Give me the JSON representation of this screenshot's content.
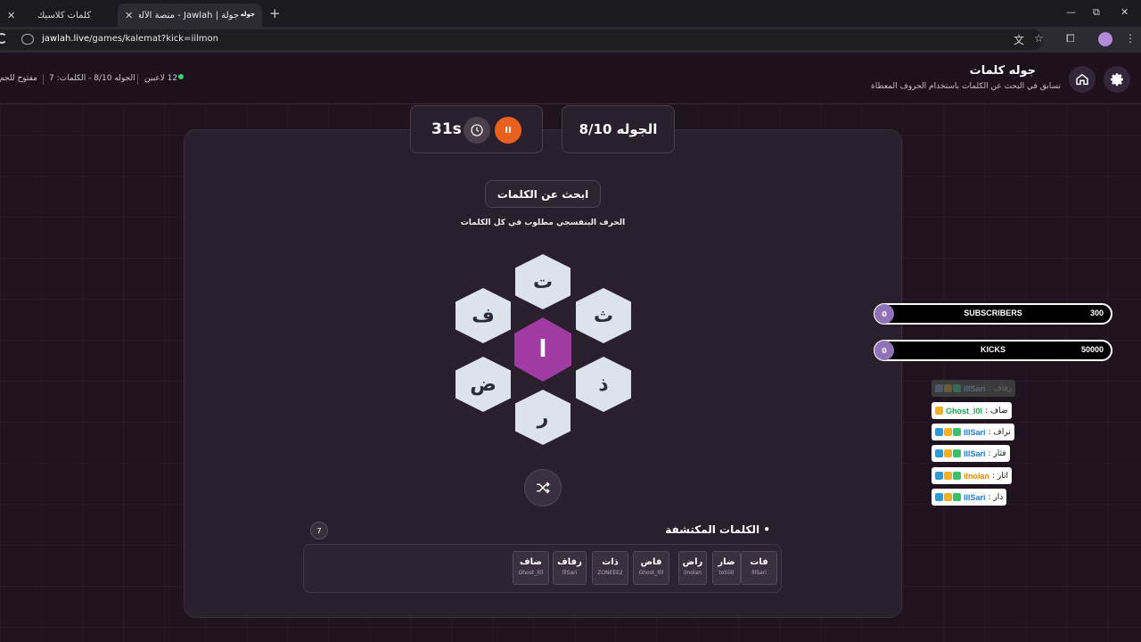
{
  "browser": {
    "tabs": [
      {
        "title": "كلمات كلاسيك"
      },
      {
        "title": "جولة | Jawlah - منصة الألعاب التـ"
      }
    ],
    "favicon_text": "جوله",
    "url_host": "jawlah.live",
    "url_path": "/games/kalemat?kick=iilmon",
    "new_tab": "+",
    "close": "✕",
    "min": "—",
    "restore": "⧉",
    "closewin": "✕"
  },
  "header": {
    "title": "جوله كلمات",
    "subtitle": "تسابق في البحث عن الكلمات باستخدام الحروف المعطاة",
    "players": "12 لاعبين",
    "round_words": "الجوله 8/10 - الكلمات: 7",
    "open": "مفتوح للجم"
  },
  "round": {
    "label": "الجوله 8/10"
  },
  "timer": {
    "value": "31s",
    "pause": "II"
  },
  "game": {
    "search_title": "ابحث عن الكلمات",
    "hint": "الحرف البنفسجي مطلوب في كل الكلمات",
    "center_letter": "ا",
    "letters": {
      "top": "ت",
      "top_right": "ث",
      "bottom_right": "ذ",
      "bottom": "ر",
      "bottom_left": "ض",
      "top_left": "ف"
    }
  },
  "found": {
    "title": "الكلمات المكتشفة",
    "bullet": "•",
    "count": "7",
    "words": [
      {
        "word": "فات",
        "player": "lllSari"
      },
      {
        "word": "ضار",
        "player": "totiii0"
      },
      {
        "word": "راض",
        "player": "ilnolan"
      },
      {
        "word": "فاض",
        "player": "Ghost_l0l"
      },
      {
        "word": "ذات",
        "player": "ZONEEE2"
      },
      {
        "word": "رفاف",
        "player": "lllSari"
      },
      {
        "word": "ضاف",
        "player": "Ghost_l0l"
      }
    ]
  },
  "overlay": {
    "subscribers": {
      "label": "SUBSCRIBERS",
      "current": "0",
      "goal": "300"
    },
    "kicks": {
      "label": "KICKS",
      "current": "0",
      "goal": "50000"
    },
    "chat": [
      {
        "user": "lllSari",
        "msg": "رفاف :",
        "faded": true
      },
      {
        "user": "Ghost_l0l",
        "msg": "ضاف :",
        "faded": false
      },
      {
        "user": "lllSari",
        "msg": "تراف :",
        "faded": false
      },
      {
        "user": "lllSari",
        "msg": "فثار :",
        "faded": false
      },
      {
        "user": "ilnolan",
        "msg": "اثار :",
        "faded": false
      },
      {
        "user": "lllSari",
        "msg": "ذار :",
        "faded": false
      }
    ]
  },
  "colors": {
    "accent": "#a23aa4",
    "pause": "#e9601f",
    "online": "#2ed36a"
  }
}
